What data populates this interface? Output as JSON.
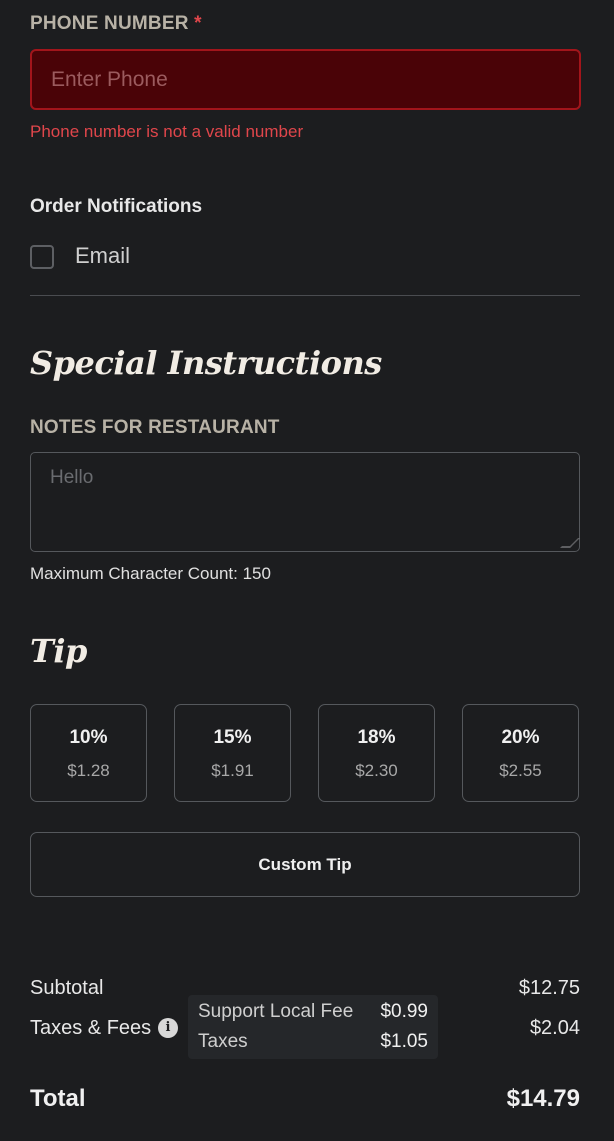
{
  "phone": {
    "label": "PHONE NUMBER",
    "required_mark": "*",
    "placeholder": "Enter Phone",
    "value": "",
    "error": "Phone number is not a valid number"
  },
  "notifications": {
    "title": "Order Notifications",
    "email_label": "Email",
    "email_checked": false
  },
  "special_instructions": {
    "heading": "Special Instructions",
    "notes_label": "NOTES FOR RESTAURANT",
    "notes_value": "",
    "notes_placeholder": "Hello",
    "max_count_text": "Maximum Character Count: 150"
  },
  "tip": {
    "heading": "Tip",
    "options": [
      {
        "percent": "10%",
        "amount": "$1.28"
      },
      {
        "percent": "15%",
        "amount": "$1.91"
      },
      {
        "percent": "18%",
        "amount": "$2.30"
      },
      {
        "percent": "20%",
        "amount": "$2.55"
      }
    ],
    "custom_label": "Custom Tip"
  },
  "summary": {
    "subtotal_label": "Subtotal",
    "subtotal_value": "$12.75",
    "taxes_label": "Taxes & Fees",
    "taxes_value": "$2.04",
    "info_icon": "info-icon",
    "tooltip": [
      {
        "label": "Support Local Fee",
        "value": "$0.99"
      },
      {
        "label": "Taxes",
        "value": "$1.05"
      }
    ],
    "total_label": "Total",
    "total_value": "$14.79"
  },
  "colors": {
    "background": "#1c1d1f",
    "error": "#e0464b",
    "error_fill": "#4a0307"
  }
}
